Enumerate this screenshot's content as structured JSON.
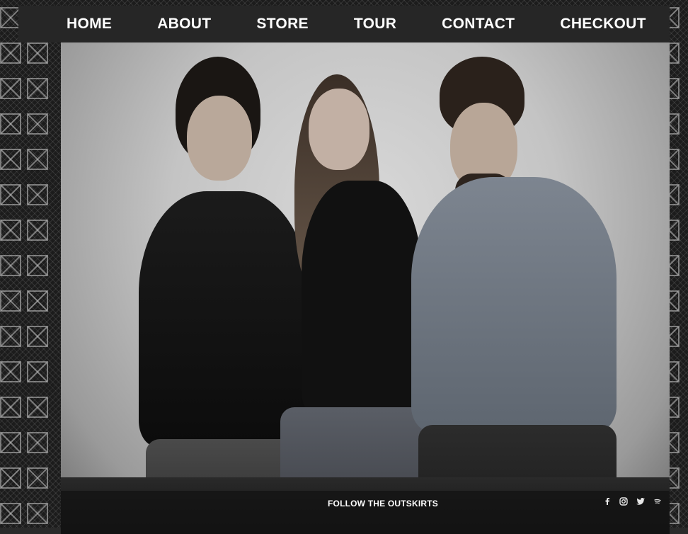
{
  "nav": {
    "items": [
      {
        "label": "HOME"
      },
      {
        "label": "ABOUT"
      },
      {
        "label": "STORE"
      },
      {
        "label": "TOUR"
      },
      {
        "label": "CONTACT"
      },
      {
        "label": "CHECKOUT"
      }
    ]
  },
  "footer": {
    "follow_label": "FOLLOW THE OUTSKIRTS",
    "social_icons": [
      "facebook-icon",
      "instagram-icon",
      "twitter-icon",
      "spotify-icon"
    ]
  },
  "colors": {
    "nav_background": "#262626",
    "nav_text": "#ffffff",
    "footer_background": "#141414"
  }
}
